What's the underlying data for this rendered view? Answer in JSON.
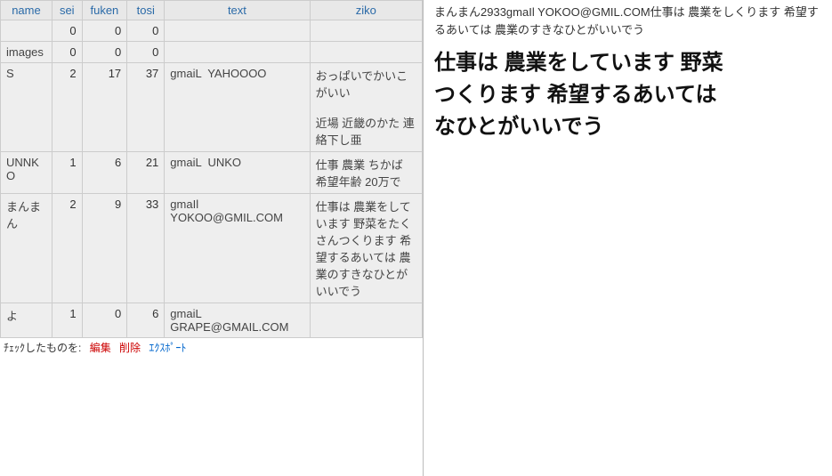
{
  "table": {
    "headers": [
      "name",
      "sei",
      "fuken",
      "tosi",
      "text",
      "ziko"
    ],
    "rows": [
      {
        "name": "",
        "sei": "0",
        "fuken": "0",
        "tosi": "0",
        "text": "",
        "ziko": ""
      },
      {
        "name": "images",
        "sei": "0",
        "fuken": "0",
        "tosi": "0",
        "text": "",
        "ziko": ""
      },
      {
        "name": "S",
        "sei": "2",
        "fuken": "17",
        "tosi": "37",
        "text": "gmaiL  YAHOOOO",
        "ziko": "おっぱいでかいこがいい\n\n近場 近畿のかた 連絡下し亜"
      },
      {
        "name": "UNNKO",
        "sei": "1",
        "fuken": "6",
        "tosi": "21",
        "text": "gmaiL  UNKO",
        "ziko": "仕事 農業 ちかば 希望年齢 20万で"
      },
      {
        "name": "まんまん",
        "sei": "2",
        "fuken": "9",
        "tosi": "33",
        "text": "gmaIl  YOKOO@GMIL.COM",
        "ziko": "仕事は 農業をしています 野菜をたくさんつくります 希望するあいては 農業のすきなひとがいいでう"
      },
      {
        "name": "よ",
        "sei": "1",
        "fuken": "0",
        "tosi": "6",
        "text": "gmaiL  GRAPE@GMAIL.COM",
        "ziko": ""
      }
    ]
  },
  "footer": {
    "left": "ﾁｪｯｸしたものを:",
    "edit": "編集",
    "delete": "削除",
    "export": "ｴｸｽﾎﾟｰﾄ"
  },
  "detail": {
    "intro": "まんまん2933gmaIl YOKOO@GMIL.COM仕事は 農業をしくります 希望するあいては 農業のすきなひとがいいでう",
    "headline_l1": "仕事は 農業をしています 野菜",
    "headline_l2": "つくります 希望するあいては",
    "headline_l3": "なひとがいいでう"
  }
}
